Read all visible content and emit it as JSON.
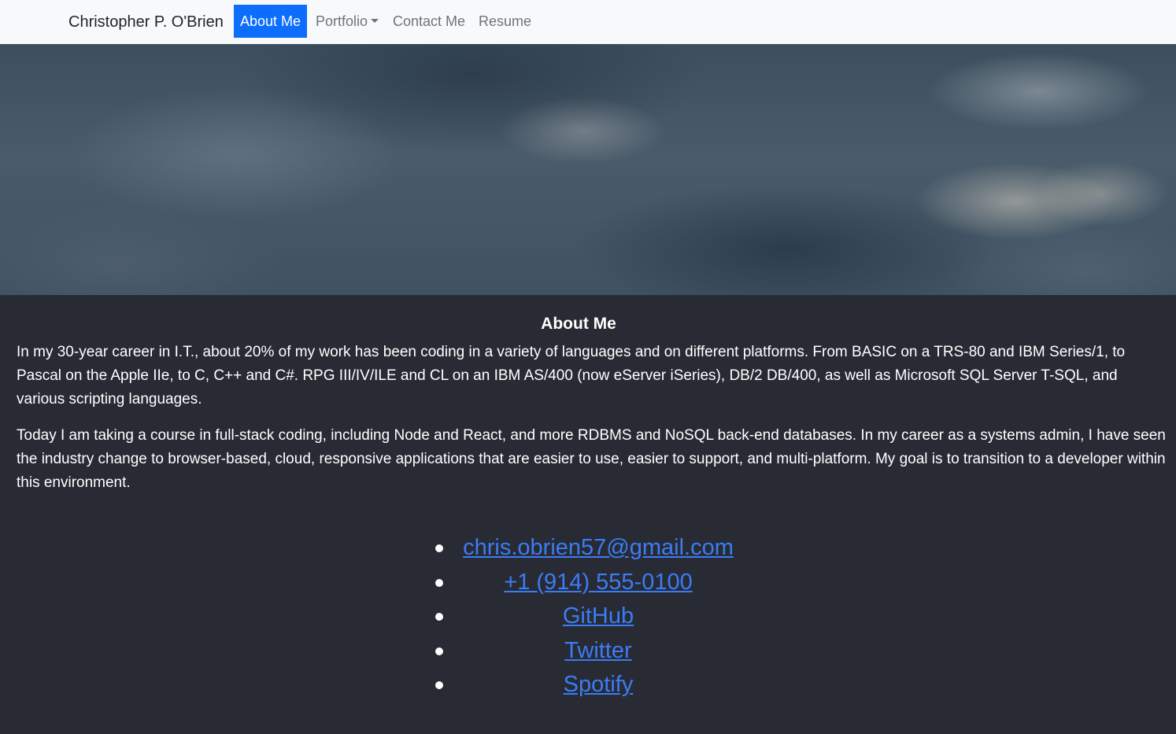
{
  "navbar": {
    "brand": "Christopher P. O'Brien",
    "items": [
      {
        "label": "About Me",
        "active": true
      },
      {
        "label": "Portfolio",
        "dropdown": true
      },
      {
        "label": "Contact Me"
      },
      {
        "label": "Resume"
      }
    ]
  },
  "about": {
    "title": "About Me",
    "paragraphs": [
      "In my 30-year career in I.T., about 20% of my work has been coding in a variety of languages and on different platforms. From BASIC on a TRS-80 and IBM Series/1, to Pascal on the Apple IIe, to C, C++ and C#. RPG III/IV/ILE and CL on an IBM AS/400 (now eServer iSeries), DB/2 DB/400, as well as Microsoft SQL Server T-SQL, and various scripting languages.",
      "Today I am taking a course in full-stack coding, including Node and React, and more RDBMS and NoSQL back-end databases. In my career as a systems admin, I have seen the industry change to browser-based, cloud, responsive applications that are easier to use, easier to support, and multi-platform. My goal is to transition to a developer within this environment."
    ]
  },
  "contact_links": [
    {
      "label": "chris.obrien57@gmail.com"
    },
    {
      "label": "+1 (914) 555-0100"
    },
    {
      "label": "GitHub"
    },
    {
      "label": "Twitter"
    },
    {
      "label": "Spotify"
    }
  ],
  "colors": {
    "navbar_bg": "#f8f9fa",
    "active_nav": "#0d6efd",
    "page_bg": "#282b34",
    "link": "#3b7cf5"
  }
}
